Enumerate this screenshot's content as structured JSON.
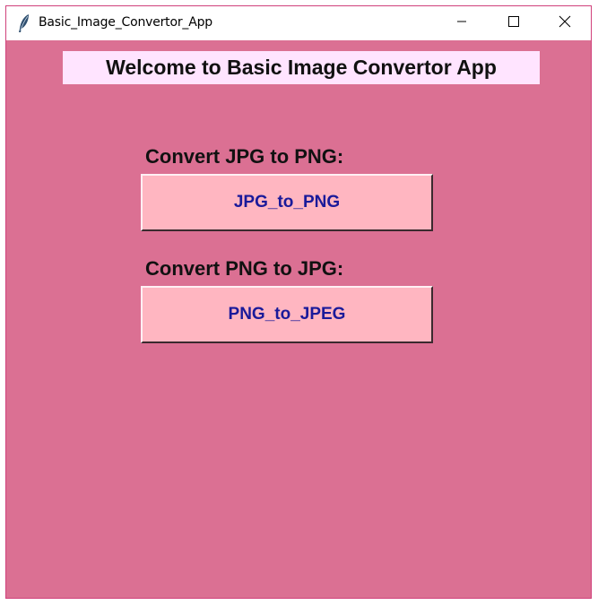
{
  "window": {
    "title": "Basic_Image_Convertor_App",
    "controls": {
      "minimize": "minimize-icon",
      "maximize": "maximize-icon",
      "close": "close-icon"
    }
  },
  "main": {
    "welcome_text": "Welcome to Basic Image Convertor App",
    "sections": [
      {
        "label": "Convert JPG to PNG:",
        "button_label": "JPG_to_PNG"
      },
      {
        "label": "Convert PNG to JPG:",
        "button_label": "PNG_to_JPEG"
      }
    ]
  },
  "colors": {
    "background": "#db7093",
    "welcome_bg": "#ffe4ff",
    "button_bg": "#ffb6c1",
    "button_text": "#1a1a9a"
  }
}
